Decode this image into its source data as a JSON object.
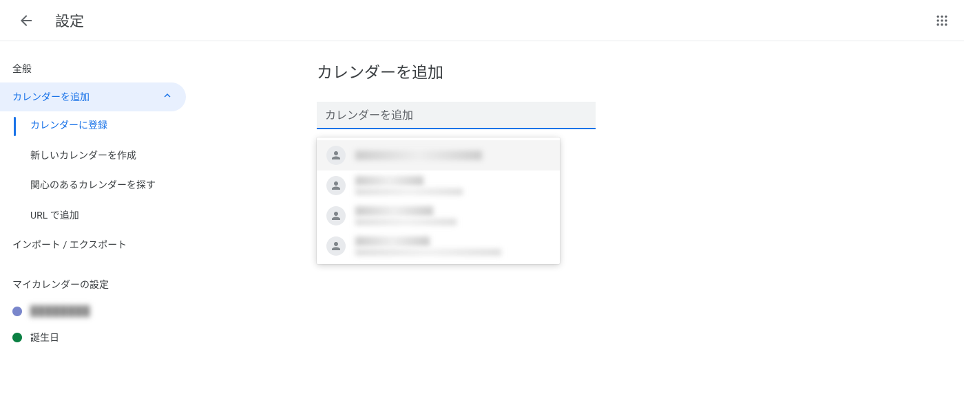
{
  "header": {
    "title": "設定"
  },
  "sidebar": {
    "general": "全般",
    "add_calendar": "カレンダーを追加",
    "subitems": {
      "subscribe": "カレンダーに登録",
      "create_new": "新しいカレンダーを作成",
      "browse_interest": "関心のあるカレンダーを探す",
      "add_by_url": "URL で追加"
    },
    "import_export": "インポート / エクスポート",
    "my_calendars_title": "マイカレンダーの設定",
    "calendars": [
      {
        "label": "████████",
        "color": "#7986cb",
        "blurred": true
      },
      {
        "label": "誕生日",
        "color": "#0b8043",
        "blurred": false
      }
    ]
  },
  "main": {
    "title": "カレンダーを追加",
    "input_placeholder": "カレンダーを追加",
    "suggestions": [
      {
        "highlighted": true
      },
      {
        "highlighted": false
      },
      {
        "highlighted": false
      },
      {
        "highlighted": false
      }
    ]
  }
}
